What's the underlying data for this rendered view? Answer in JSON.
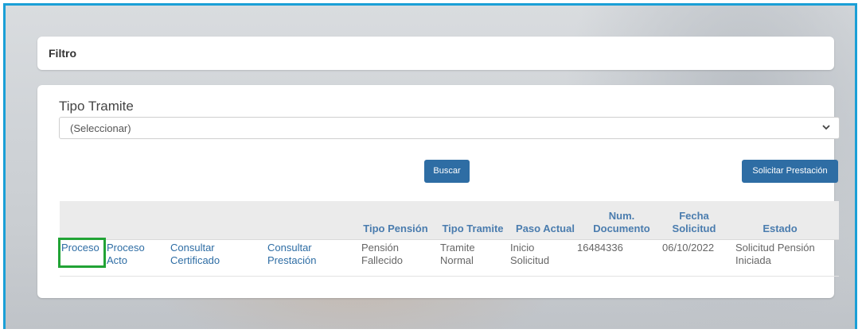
{
  "filter": {
    "title": "Filtro"
  },
  "form": {
    "tipo_label": "Tipo Tramite",
    "tipo_selected": "(Seleccionar)"
  },
  "buttons": {
    "buscar": "Buscar",
    "solicitar": "Solicitar Prestación"
  },
  "table": {
    "headers": {
      "tipo_pension": "Tipo Pensión",
      "tipo_tramite": "Tipo Tramite",
      "paso_actual": "Paso Actual",
      "num_doc_1": "Num.",
      "num_doc_2": "Documento",
      "fecha_1": "Fecha",
      "fecha_2": "Solicitud",
      "estado": "Estado"
    },
    "row": {
      "proceso": "Proceso",
      "proceso_acto_1": "Proceso",
      "proceso_acto_2": "Acto",
      "consultar_cert_1": "Consultar",
      "consultar_cert_2": "Certificado",
      "consultar_prest_1": "Consultar",
      "consultar_prest_2": "Prestación",
      "tipo_pension_1": "Pensión",
      "tipo_pension_2": "Fallecido",
      "tipo_tramite_1": "Tramite",
      "tipo_tramite_2": "Normal",
      "paso_actual_1": "Inicio",
      "paso_actual_2": "Solicitud",
      "num_documento": "16484336",
      "fecha_solicitud": "06/10/2022",
      "estado_1": "Solicitud Pensión",
      "estado_2": "Iniciada"
    }
  },
  "colors": {
    "accent": "#2e6da4",
    "frame": "#1a9fd6",
    "highlight": "#21a335"
  }
}
